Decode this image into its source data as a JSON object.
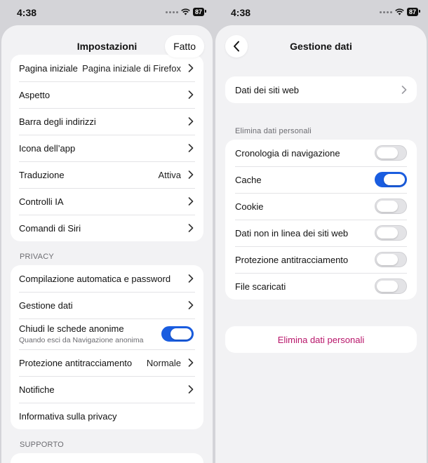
{
  "left": {
    "status": {
      "time": "4:38",
      "battery": "87"
    },
    "nav": {
      "title": "Impostazioni",
      "done": "Fatto"
    },
    "general": [
      {
        "label": "Pagina iniziale",
        "value": "Pagina iniziale di Firefox"
      },
      {
        "label": "Aspetto",
        "value": ""
      },
      {
        "label": "Barra degli indirizzi",
        "value": ""
      },
      {
        "label": "Icona dell’app",
        "value": ""
      },
      {
        "label": "Traduzione",
        "value": "Attiva"
      },
      {
        "label": "Controlli IA",
        "value": ""
      },
      {
        "label": "Comandi di Siri",
        "value": ""
      }
    ],
    "privacy_header": "PRIVACY",
    "privacy": {
      "autofill": "Compilazione automatica e password",
      "data_mgmt": "Gestione dati",
      "close_private": "Chiudi le schede anonime",
      "close_private_sub": "Quando esci da Navigazione anonima",
      "close_private_on": true,
      "tracking": "Protezione antitracciamento",
      "tracking_value": "Normale",
      "notifications": "Notifiche",
      "privacy_policy": "Informativa sulla privacy"
    },
    "support_header": "SUPPORTO"
  },
  "right": {
    "status": {
      "time": "4:38",
      "battery": "87"
    },
    "nav": {
      "title": "Gestione dati"
    },
    "website_data": "Dati dei siti web",
    "clear_header": "Elimina dati personali",
    "items": [
      {
        "label": "Cronologia di navigazione",
        "on": false
      },
      {
        "label": "Cache",
        "on": true
      },
      {
        "label": "Cookie",
        "on": false
      },
      {
        "label": "Dati non in linea dei siti web",
        "on": false
      },
      {
        "label": "Protezione antitracciamento",
        "on": false
      },
      {
        "label": "File scaricati",
        "on": false
      }
    ],
    "clear_button": "Elimina dati personali"
  },
  "colors": {
    "accent": "#1a5de0",
    "destructive": "#b8156a",
    "background": "#f2f2f4"
  },
  "icons": {
    "chevron": "chevron-right-icon",
    "back": "chevron-left-icon",
    "wifi": "wifi-icon"
  }
}
